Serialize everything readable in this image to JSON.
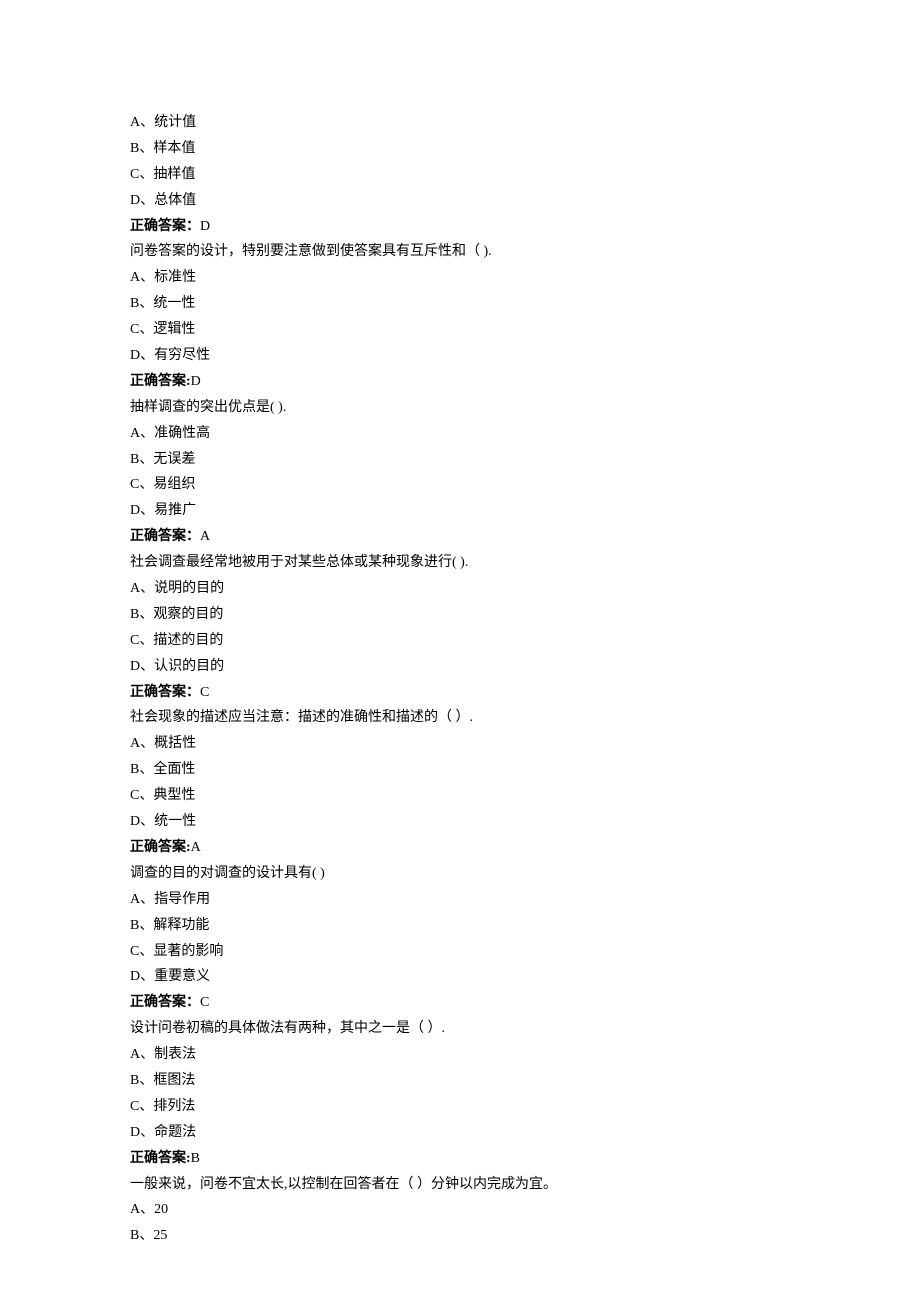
{
  "questions": [
    {
      "options": [
        "A、统计值",
        "B、样本值",
        "C、抽样值",
        "D、总体值"
      ],
      "answer_label": "正确答案：",
      "answer_value": "D"
    },
    {
      "text": "问卷答案的设计，特别要注意做到使答案具有互斥性和（ ).",
      "options": [
        "A、标准性",
        "B、统一性",
        "C、逻辑性",
        "D、有穷尽性"
      ],
      "answer_label": "正确答案:",
      "answer_value": "D"
    },
    {
      "text": "抽样调查的突出优点是( ).",
      "options": [
        "A、准确性高",
        "B、无误差",
        "C、易组织",
        "D、易推广"
      ],
      "answer_label": "正确答案：",
      "answer_value": "A"
    },
    {
      "text": "社会调查最经常地被用于对某些总体或某种现象进行( ).",
      "options": [
        "A、说明的目的",
        "B、观察的目的",
        "C、描述的目的",
        "D、认识的目的"
      ],
      "answer_label": "正确答案：",
      "answer_value": "C"
    },
    {
      "text": "社会现象的描述应当注意：描述的准确性和描述的（ ）.",
      "options": [
        "A、概括性",
        "B、全面性",
        "C、典型性",
        "D、统一性"
      ],
      "answer_label": "正确答案:",
      "answer_value": "A"
    },
    {
      "text": "调查的目的对调查的设计具有( )",
      "options": [
        "A、指导作用",
        "B、解释功能",
        "C、显著的影响",
        "D、重要意义"
      ],
      "answer_label": "正确答案：",
      "answer_value": "C"
    },
    {
      "text": "设计问卷初稿的具体做法有两种，其中之一是（ ）.",
      "options": [
        "A、制表法",
        "B、框图法",
        "C、排列法",
        "D、命题法"
      ],
      "answer_label": "正确答案:",
      "answer_value": "B"
    },
    {
      "text": "一般来说，问卷不宜太长,以控制在回答者在（ ）分钟以内完成为宜。",
      "options": [
        "A、20",
        "B、25"
      ],
      "answer_label": "",
      "answer_value": ""
    }
  ]
}
